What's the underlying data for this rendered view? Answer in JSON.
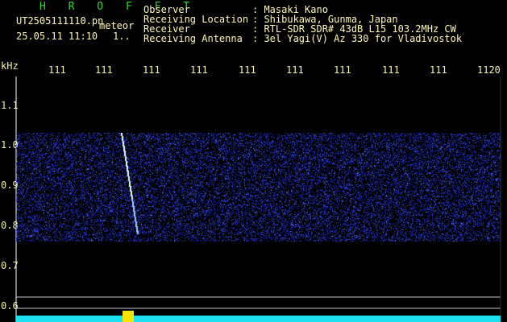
{
  "header": {
    "title": "H R O F F T",
    "filename": "UT2505111110.pn",
    "meteor_label": "meteor",
    "datetime": "25.05.11 11:10",
    "counter": "1..",
    "observer_label": "Observer",
    "observer_value": ": Masaki Kano",
    "location_label": "Receiving Location",
    "location_value": ": Shibukawa, Gunma, Japan",
    "receiver_label": "Receiver",
    "receiver_value": ": RTL-SDR SDR# 43dB L15 103.2MHz CW",
    "antenna_label": "Receiving Antenna",
    "antenna_value": ": 3el Yagi(V) Az 330 for Vladivostok"
  },
  "axes": {
    "y_unit": "kHz",
    "x_ticks": [
      "111",
      "111",
      "111",
      "111",
      "111",
      "111",
      "111",
      "111",
      "111",
      "1120"
    ],
    "y_ticks": [
      "1.1",
      "1.0",
      "0.9",
      "0.8",
      "0.7",
      "0.6"
    ]
  },
  "colors": {
    "background": "#000000",
    "noise": "#1f2cbc",
    "noise_light": "#5f86ff",
    "meteor": "#dfffff",
    "grid": "#c8c8c8",
    "strip": "#19e2ef",
    "marker": "#f6e700"
  }
}
